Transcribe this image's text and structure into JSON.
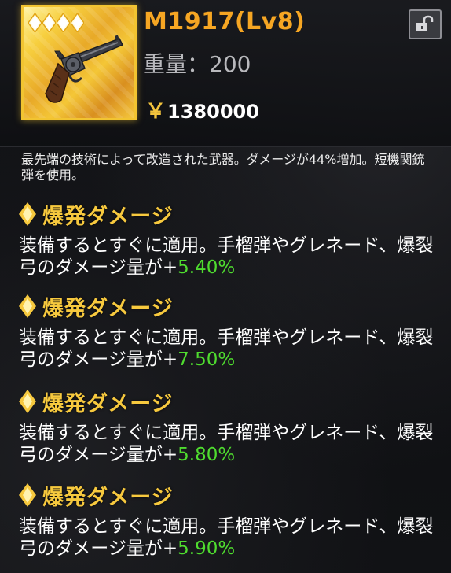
{
  "item": {
    "name": "M1917(Lv8)",
    "rarity_stars": 4,
    "weight_label": "重量：",
    "weight_value": "200",
    "currency_symbol": "￥",
    "price": "1380000",
    "frame_color": "#f2c431",
    "icon": "revolver-icon",
    "lock_icon": "lock-icon"
  },
  "description": "最先端の技術によって改造された武器。ダメージが44%増加。短機関銃弾を使用。",
  "effects": [
    {
      "title": "爆発ダメージ",
      "text": "装備するとすぐに適用。手榴弾やグレネード、爆裂弓のダメージ量が",
      "sign": "+",
      "value": "5.40%"
    },
    {
      "title": "爆発ダメージ",
      "text": "装備するとすぐに適用。手榴弾やグレネード、爆裂弓のダメージ量が",
      "sign": "+",
      "value": "7.50%"
    },
    {
      "title": "爆発ダメージ",
      "text": "装備するとすぐに適用。手榴弾やグレネード、爆裂弓のダメージ量が",
      "sign": "+",
      "value": "5.80%"
    },
    {
      "title": "爆発ダメージ",
      "text": "装備するとすぐに適用。手榴弾やグレネード、爆裂弓のダメージ量が",
      "sign": "+",
      "value": "5.90%"
    }
  ],
  "colors": {
    "title_orange": "#f6a623",
    "effect_gold": "#f7c93e",
    "value_green": "#4fdc2f",
    "weight_gray": "#b9b9bd"
  }
}
